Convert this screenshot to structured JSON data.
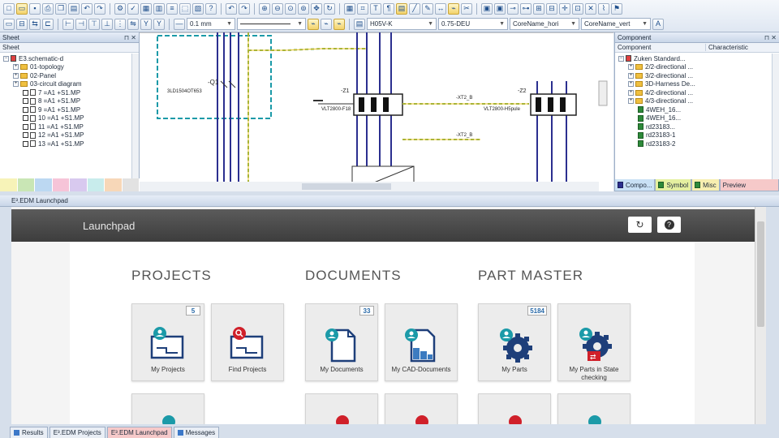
{
  "toolbar": {
    "line_width": "0.1 mm",
    "wire_type": "H05V-K",
    "cross_section": "0.75-DEU",
    "core_name_h": "CoreName_hori",
    "core_name_v": "CoreName_vert"
  },
  "sheet_panel": {
    "title": "Sheet",
    "column": "Sheet",
    "items": [
      {
        "label": "E3.schematic-d",
        "level": 1,
        "kind": "root"
      },
      {
        "label": "01-topology",
        "level": 2,
        "kind": "folder"
      },
      {
        "label": "02-Panel",
        "level": 2,
        "kind": "folder"
      },
      {
        "label": "03-circuit diagram",
        "level": 2,
        "kind": "folder"
      },
      {
        "label": "7 =A1 +S1.MP",
        "level": 3,
        "kind": "sheet"
      },
      {
        "label": "8 =A1 +S1.MP",
        "level": 3,
        "kind": "sheet"
      },
      {
        "label": "9 =A1 +S1.MP",
        "level": 3,
        "kind": "sheet"
      },
      {
        "label": "10 =A1 +S1.MP",
        "level": 3,
        "kind": "sheet"
      },
      {
        "label": "11 =A1 +S1.MP",
        "level": 3,
        "kind": "sheet"
      },
      {
        "label": "12 =A1 +S1.MP",
        "level": 3,
        "kind": "sheet"
      },
      {
        "label": "13 =A1 +S1.MP",
        "level": 3,
        "kind": "sheet"
      }
    ]
  },
  "canvas": {
    "labels": {
      "q1": "-Q1",
      "breaker": "3LD1504OT653",
      "z1": "-Z1",
      "z2": "-Z2",
      "vlt1": "VLT2800-F18",
      "vlt2": "VLT2800-H5pule",
      "xt2a": "-XT2_B",
      "xt2b": "-XT2_B"
    }
  },
  "component_panel": {
    "title": "Component",
    "col1": "Component",
    "col2": "Characteristic",
    "items": [
      {
        "label": "Zuken Standard...",
        "level": 1,
        "kind": "root"
      },
      {
        "label": "2/2-directional ...",
        "level": 2,
        "kind": "folder"
      },
      {
        "label": "3/2-directional ...",
        "level": 2,
        "kind": "folder"
      },
      {
        "label": "3D-Harness De...",
        "level": 2,
        "kind": "folder"
      },
      {
        "label": "4/2-directional ...",
        "level": 2,
        "kind": "folder"
      },
      {
        "label": "4/3-directional ...",
        "level": 2,
        "kind": "folder"
      },
      {
        "label": "4WEH_16...",
        "level": 3,
        "kind": "part"
      },
      {
        "label": "4WEH_16...",
        "level": 3,
        "kind": "part"
      },
      {
        "label": "rd23183...",
        "level": 3,
        "kind": "part"
      },
      {
        "label": "rd23183-1",
        "level": 3,
        "kind": "part"
      },
      {
        "label": "rd23183-2",
        "level": 3,
        "kind": "part"
      }
    ],
    "tabs": [
      "Compo...",
      "Symbol",
      "Misc",
      "Preview"
    ]
  },
  "launchpad_window": {
    "title": "E³.EDM Launchpad",
    "header": "Launchpad",
    "sections": [
      {
        "title": "PROJECTS",
        "tiles": [
          {
            "label": "My Projects",
            "badge": "5"
          },
          {
            "label": "Find Projects",
            "badge": ""
          }
        ]
      },
      {
        "title": "DOCUMENTS",
        "tiles": [
          {
            "label": "My Documents",
            "badge": "33"
          },
          {
            "label": "My CAD-Documents",
            "badge": ""
          }
        ]
      },
      {
        "title": "PART MASTER",
        "tiles": [
          {
            "label": "My Parts",
            "badge": "5184"
          },
          {
            "label": "My Parts in State checking",
            "badge": ""
          }
        ]
      }
    ]
  },
  "bottom_tabs": [
    "Results",
    "E³.EDM Projects",
    "E³.EDM Launchpad",
    "Messages"
  ],
  "colors": {
    "accent_teal": "#1b9aa8",
    "doc_navy": "#1e3f7a",
    "search_red": "#d0202a",
    "active_tab": "#f6c9c9"
  }
}
